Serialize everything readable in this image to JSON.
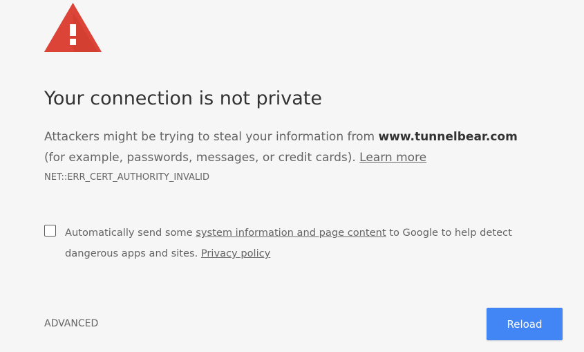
{
  "colors": {
    "background": "#f6f6f6",
    "warning_red": "#db4437",
    "accent_blue": "#4285f4",
    "text_primary": "#333333",
    "text_secondary": "#646464"
  },
  "icon": {
    "name": "warning-triangle-icon",
    "glyph": "!"
  },
  "heading": "Your connection is not private",
  "explanation": {
    "prefix": "Attackers might be trying to steal your information from ",
    "domain": "www.tunnelbear.com",
    "suffix": " (for example, passwords, messages, or credit cards). ",
    "learn_more": "Learn more"
  },
  "error_code": "NET::ERR_CERT_AUTHORITY_INVALID",
  "optin": {
    "checked": false,
    "prefix": "Automatically send some ",
    "link1": "system information and page content",
    "middle": " to Google to help detect dangerous apps and sites. ",
    "link2": "Privacy policy"
  },
  "buttons": {
    "advanced": "ADVANCED",
    "reload": "Reload"
  }
}
